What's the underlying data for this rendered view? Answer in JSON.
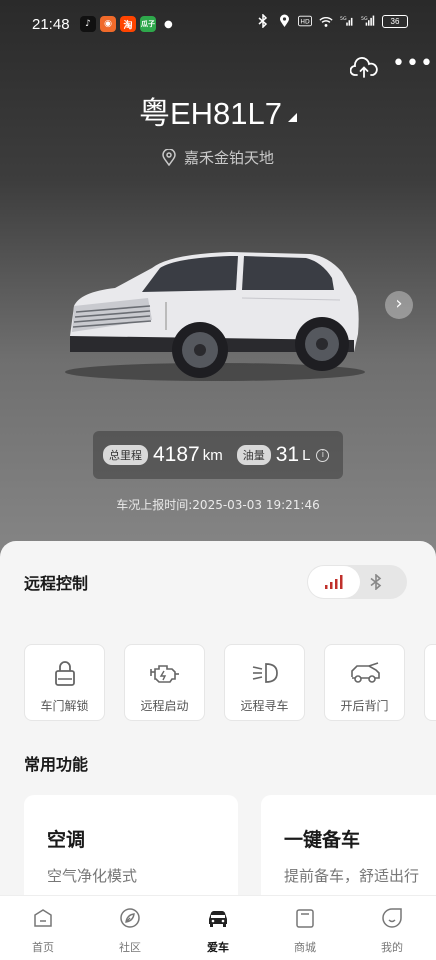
{
  "status_bar": {
    "time": "21:48",
    "battery": "36",
    "apps": [
      {
        "icon": "tiktok-icon",
        "color": "#111111",
        "text": "♪"
      },
      {
        "icon": "orange-app-icon",
        "color": "#f06a2a",
        "text": "◉"
      },
      {
        "icon": "taobao-icon",
        "color": "#ff4400",
        "text": "淘"
      },
      {
        "icon": "green-app-icon",
        "color": "#2ea84b",
        "text": "瓜子"
      }
    ]
  },
  "vehicle": {
    "plate": "粤EH81L7",
    "location": "嘉禾金铂天地",
    "mileage_label": "总里程",
    "mileage_value": "4187",
    "mileage_unit": "km",
    "fuel_label": "油量",
    "fuel_value": "31",
    "fuel_unit": "L",
    "report_time": "车况上报时间:2025-03-03 19:21:46"
  },
  "remote_control": {
    "title": "远程控制",
    "items": [
      {
        "label": "车门解锁",
        "icon": "lock-icon"
      },
      {
        "label": "远程启动",
        "icon": "engine-icon"
      },
      {
        "label": "远程寻车",
        "icon": "headlight-icon"
      },
      {
        "label": "开后背门",
        "icon": "tailgate-icon"
      }
    ]
  },
  "common_functions": {
    "title": "常用功能",
    "cards": [
      {
        "title": "空调",
        "subtitle": "空气净化模式"
      },
      {
        "title": "一键备车",
        "subtitle": "提前备车，舒适出行"
      }
    ]
  },
  "tabbar": {
    "active": 2,
    "items": [
      {
        "label": "首页",
        "icon": "home-icon"
      },
      {
        "label": "社区",
        "icon": "community-icon"
      },
      {
        "label": "爱车",
        "icon": "car-icon"
      },
      {
        "label": "商城",
        "icon": "shop-icon"
      },
      {
        "label": "我的",
        "icon": "profile-icon"
      }
    ]
  },
  "colors": {
    "signal_active": "#c0302b",
    "sheet_background": "#f5f5f5"
  }
}
